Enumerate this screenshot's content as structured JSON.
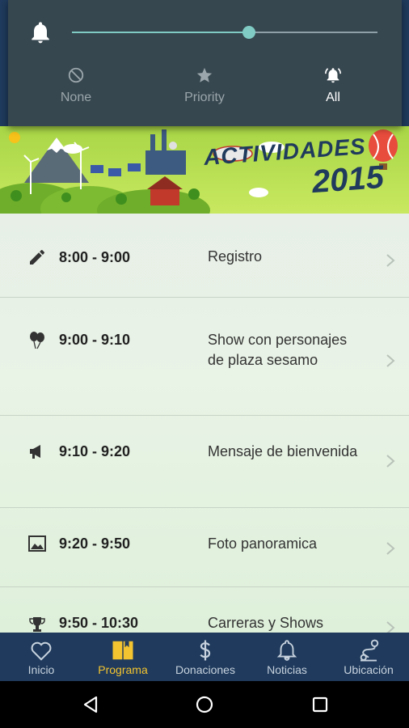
{
  "shade": {
    "volume_level_percent": 58,
    "modes": [
      {
        "label": "None",
        "icon": "block-icon",
        "active": false
      },
      {
        "label": "Priority",
        "icon": "star-icon",
        "active": false
      },
      {
        "label": "All",
        "icon": "bell-ringing-icon",
        "active": true
      }
    ]
  },
  "banner": {
    "title": "ACTIVIDADES",
    "year": "2015"
  },
  "schedule": [
    {
      "time": "8:00 - 9:00",
      "title": "Registro",
      "icon": "pencil-icon"
    },
    {
      "time": "9:00 - 9:10",
      "title": "Show con personajes de plaza sesamo",
      "icon": "balloons-icon"
    },
    {
      "time": "9:10 - 9:20",
      "title": "Mensaje de bienvenida",
      "icon": "megaphone-icon"
    },
    {
      "time": "9:20 - 9:50",
      "title": "Foto panoramica",
      "icon": "image-icon"
    },
    {
      "time": "9:50 - 10:30",
      "title": "Carreras y Shows",
      "icon": "trophy-icon"
    }
  ],
  "bottom_nav": [
    {
      "label": "Inicio",
      "icon": "heart-icon",
      "active": false
    },
    {
      "label": "Programa",
      "icon": "book-icon",
      "active": true
    },
    {
      "label": "Donaciones",
      "icon": "dollar-icon",
      "active": false
    },
    {
      "label": "Noticias",
      "icon": "bell-icon",
      "active": false
    },
    {
      "label": "Ubicación",
      "icon": "map-pin-icon",
      "active": false
    }
  ],
  "colors": {
    "nav_background": "#1f3a5c",
    "nav_active": "#f4c430",
    "slider_accent": "#80cbc4",
    "shade_background": "#37474f",
    "banner_green": "#a8d646"
  }
}
